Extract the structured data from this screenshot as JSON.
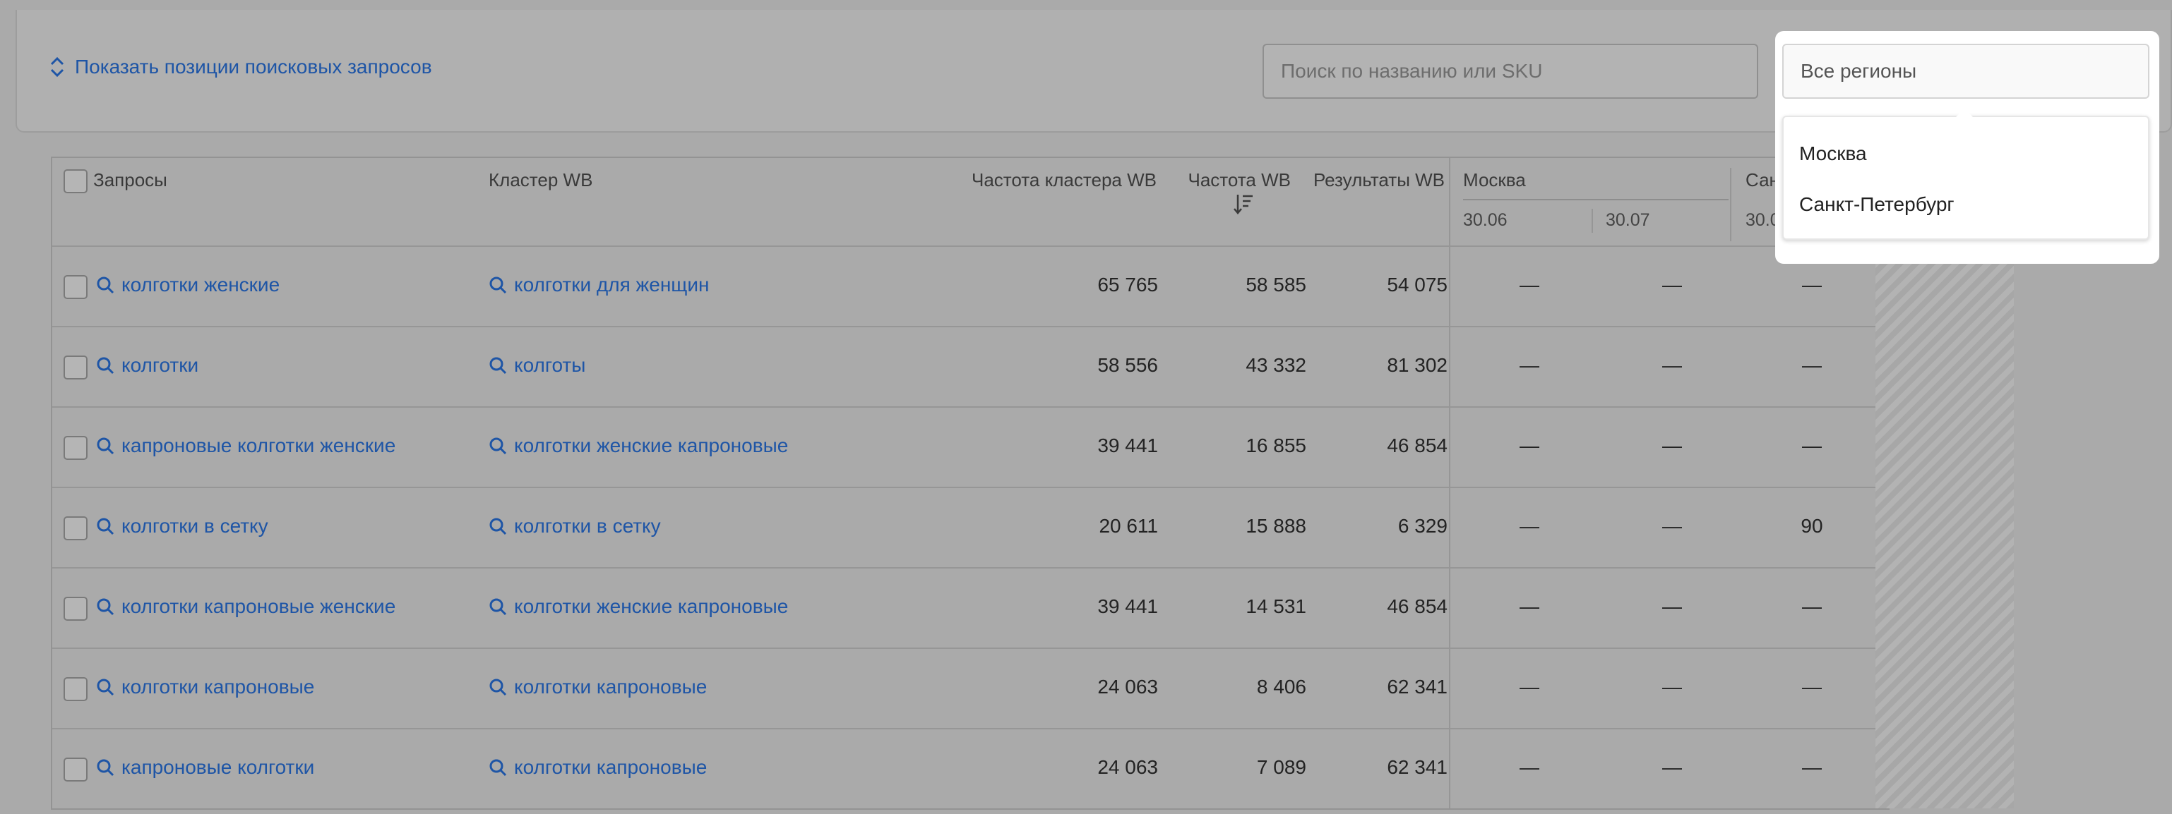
{
  "filters": {
    "toggle_label": "Показать позиции поисковых запросов",
    "search_placeholder": "Поиск по названию или SKU",
    "region_value": "Все регионы",
    "region_options": [
      "Москва",
      "Санкт-Петербург"
    ]
  },
  "table": {
    "headers": {
      "queries": "Запросы",
      "cluster": "Кластер WB",
      "cluster_freq": "Частота кластера WB",
      "freq": "Частота WB",
      "results": "Результаты WB",
      "region1": "Москва",
      "region2_partial": "Сан",
      "date1": "30.06",
      "date2": "30.07",
      "date3": "30.0"
    },
    "rows": [
      {
        "query": "колготки женские",
        "cluster": "колготки для женщин",
        "cluster_freq": "65 765",
        "freq": "58 585",
        "results": "54 075",
        "m1": "—",
        "m2": "—",
        "s1": "—"
      },
      {
        "query": "колготки",
        "cluster": "колготы",
        "cluster_freq": "58 556",
        "freq": "43 332",
        "results": "81 302",
        "m1": "—",
        "m2": "—",
        "s1": "—"
      },
      {
        "query": "капроновые колготки женские",
        "cluster": "колготки женские капроновые",
        "cluster_freq": "39 441",
        "freq": "16 855",
        "results": "46 854",
        "m1": "—",
        "m2": "—",
        "s1": "—"
      },
      {
        "query": "колготки в сетку",
        "cluster": "колготки в сетку",
        "cluster_freq": "20 611",
        "freq": "15 888",
        "results": "6 329",
        "m1": "—",
        "m2": "—",
        "s1": "90"
      },
      {
        "query": "колготки капроновые женские",
        "cluster": "колготки женские капроновые",
        "cluster_freq": "39 441",
        "freq": "14 531",
        "results": "46 854",
        "m1": "—",
        "m2": "—",
        "s1": "—"
      },
      {
        "query": "колготки капроновые",
        "cluster": "колготки капроновые",
        "cluster_freq": "24 063",
        "freq": "8 406",
        "results": "62 341",
        "m1": "—",
        "m2": "—",
        "s1": "—"
      },
      {
        "query": "капроновые колготки",
        "cluster": "колготки капроновые",
        "cluster_freq": "24 063",
        "freq": "7 089",
        "results": "62 341",
        "m1": "—",
        "m2": "—",
        "s1": "—"
      }
    ]
  },
  "colors": {
    "link": "#1e55a6",
    "overlay_bg": "#aaaaaa",
    "dropdown_bg": "#ffffff"
  },
  "icons": [
    "chevron-updown-icon",
    "search-icon",
    "sort-desc-icon"
  ]
}
